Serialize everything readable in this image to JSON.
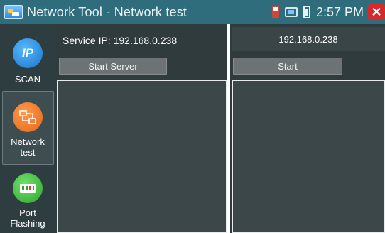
{
  "titlebar": {
    "title": "Network Tool - Network test",
    "time": "2:57 PM",
    "close_label": "✕"
  },
  "sidebar": {
    "items": [
      {
        "label": "SCAN",
        "icon_text": "IP"
      },
      {
        "label_line1": "Network",
        "label_line2": "test"
      },
      {
        "label_line1": "Port",
        "label_line2": "Flashing"
      }
    ]
  },
  "main": {
    "service_ip_label": "Service IP: 192.168.0.238",
    "target_ip": "192.168.0.238",
    "start_server_label": "Start Server",
    "start_label": "Start"
  },
  "colors": {
    "titlebar": "#2f6d7d",
    "sidebar": "#2d3d40",
    "close": "#d62a2a"
  }
}
